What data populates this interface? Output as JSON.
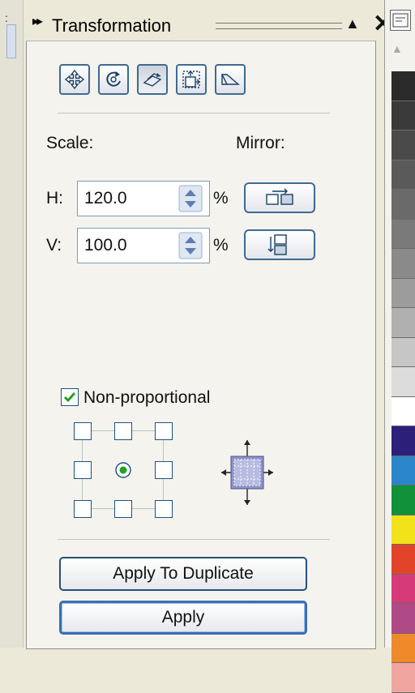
{
  "window": {
    "title": "Transformation",
    "expand_glyph": "▸▸",
    "collapse_glyph": "▲",
    "close_glyph": "✕"
  },
  "toolbar": {
    "tools": [
      {
        "name": "position-tool",
        "icon": "move-arrows-icon",
        "active": false
      },
      {
        "name": "rotate-tool",
        "icon": "rotate-icon",
        "active": false
      },
      {
        "name": "scale-mirror-tool",
        "icon": "scale-mirror-icon",
        "active": true
      },
      {
        "name": "size-tool",
        "icon": "size-icon",
        "active": false
      },
      {
        "name": "skew-tool",
        "icon": "skew-icon",
        "active": false
      }
    ]
  },
  "scale": {
    "label": "Scale:",
    "mirror_label": "Mirror:",
    "h_label": "H:",
    "h_value": "120.0",
    "v_label": "V:",
    "v_value": "100.0",
    "unit": "%"
  },
  "options": {
    "non_proportional_label": "Non-proportional",
    "non_proportional_checked": true,
    "anchor_selected": "center"
  },
  "buttons": {
    "apply_duplicate": "Apply To Duplicate",
    "apply": "Apply"
  },
  "palette": {
    "swatches": [
      "#2a2a2a",
      "#3a3a3a",
      "#4a4a4a",
      "#5a5a5a",
      "#6a6a6a",
      "#7a7a7a",
      "#8a8a8a",
      "#9c9c9c",
      "#b0b0b0",
      "#c6c6c6",
      "#dcdcdc",
      "#ffffff",
      "#2b1f7a",
      "#2a86c8",
      "#10913a",
      "#f2e21a",
      "#e2442a",
      "#d63a78",
      "#b04a86",
      "#ee8a2a",
      "#f0a4a0"
    ]
  }
}
